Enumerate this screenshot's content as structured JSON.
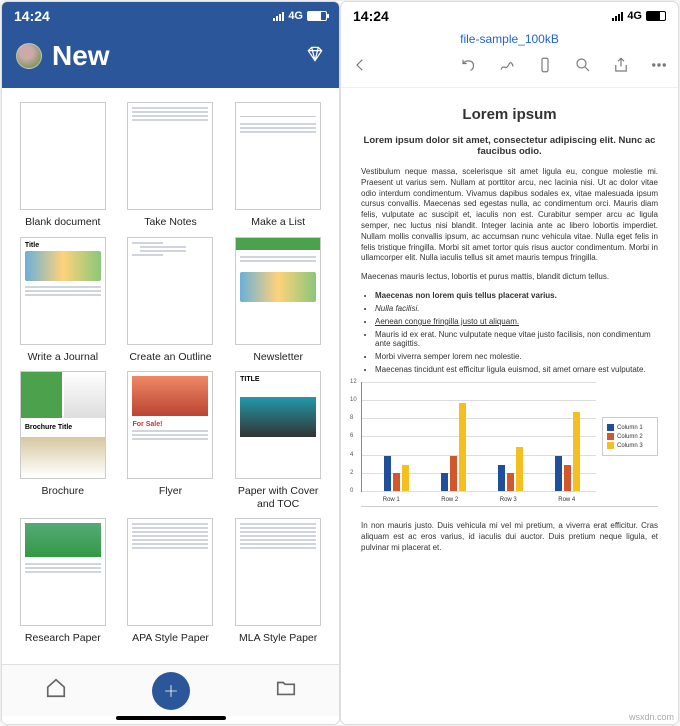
{
  "left_phone": {
    "status": {
      "time": "14:24",
      "network": "4G"
    },
    "header": {
      "title": "New"
    },
    "templates": [
      {
        "label": "Blank document"
      },
      {
        "label": "Take Notes"
      },
      {
        "label": "Make a List"
      },
      {
        "label": "Write a Journal"
      },
      {
        "label": "Create an Outline"
      },
      {
        "label": "Newsletter"
      },
      {
        "label": "Brochure"
      },
      {
        "label": "Flyer"
      },
      {
        "label": "Paper with Cover and TOC"
      },
      {
        "label": "Research Paper"
      },
      {
        "label": "APA Style Paper"
      },
      {
        "label": "MLA Style Paper"
      }
    ]
  },
  "right_phone": {
    "status": {
      "time": "14:24",
      "network": "4G"
    },
    "filename": "file-sample_100kB",
    "doc": {
      "title": "Lorem ipsum",
      "subtitle": "Lorem ipsum dolor sit amet, consectetur adipiscing elit. Nunc ac faucibus odio.",
      "p1": "Vestibulum neque massa, scelerisque sit amet ligula eu, congue molestie mi. Praesent ut varius sem. Nullam at porttitor arcu, nec lacinia nisi. Ut ac dolor vitae odio interdum condimentum. Vivamus dapibus sodales ex, vitae malesuada ipsum cursus convallis. Maecenas sed egestas nulla, ac condimentum orci. Mauris diam felis, vulputate ac suscipit et, iaculis non est. Curabitur semper arcu ac ligula semper, nec luctus nisi blandit. Integer lacinia ante ac libero lobortis imperdiet. Nullam mollis convallis ipsum, ac accumsan nunc vehicula vitae. Nulla eget felis in felis tristique fringilla. Morbi sit amet tortor quis risus auctor condimentum. Morbi in ullamcorper elit. Nulla iaculis tellus sit amet mauris tempus fringilla.",
      "p2": "Maecenas mauris lectus, lobortis et purus mattis, blandit dictum tellus.",
      "bullets": [
        "Maecenas non lorem quis tellus placerat varius.",
        "Nulla facilisi.",
        "Aenean congue fringilla justo ut aliquam.",
        "Mauris id ex erat. Nunc vulputate neque vitae justo facilisis, non condimentum ante sagittis.",
        "Morbi viverra semper lorem nec molestie.",
        "Maecenas tincidunt est efficitur ligula euismod, sit amet ornare est vulputate."
      ],
      "p3": "In non mauris justo. Duis vehicula mi vel mi pretium, a viverra erat efficitur. Cras aliquam est ac eros varius, id iaculis dui auctor. Duis pretium neque ligula, et pulvinar mi placerat et."
    }
  },
  "chart_data": {
    "type": "bar",
    "categories": [
      "Row 1",
      "Row 2",
      "Row 3",
      "Row 4"
    ],
    "series": [
      {
        "name": "Column 1",
        "color": "#1f4e9b",
        "values": [
          4,
          2,
          3,
          4
        ]
      },
      {
        "name": "Column 2",
        "color": "#d1582c",
        "values": [
          2,
          4,
          2,
          3
        ]
      },
      {
        "name": "Column 3",
        "color": "#f4c020",
        "values": [
          3,
          10,
          5,
          9
        ]
      }
    ],
    "ylim": [
      0,
      12
    ],
    "yticks": [
      0,
      2,
      4,
      6,
      8,
      10,
      12
    ],
    "legend": [
      "Column 1",
      "Column 2",
      "Column 3"
    ]
  },
  "watermark": "wsxdn.com"
}
